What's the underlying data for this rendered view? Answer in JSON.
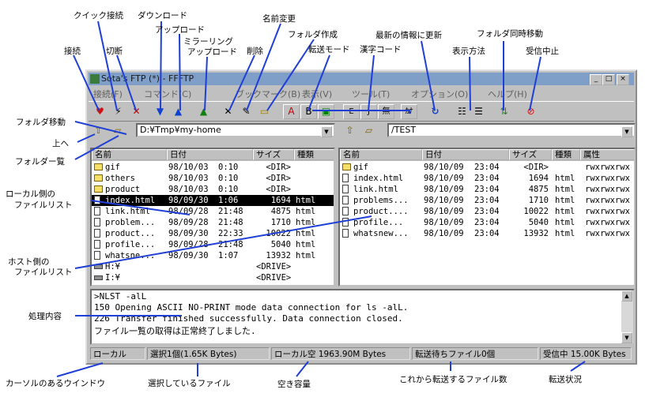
{
  "window": {
    "title": "Sota's FTP (*) - FFFTP",
    "buttons": [
      "_",
      "□",
      "×"
    ]
  },
  "menu": [
    "接続(F)",
    "コマンド(C)",
    "ブックマーク(B)",
    "表示(V)",
    "ツール(T)",
    "オプション(O)",
    "ヘルプ(H)"
  ],
  "local": {
    "path": "D:¥Tmp¥my-home",
    "headers": [
      "名前",
      "日付",
      "サイズ",
      "種類"
    ],
    "rows": [
      {
        "icon": "folder-icon",
        "name": "gif",
        "date": "98/10/03",
        "time": "0:10",
        "size": "<DIR>",
        "type": ""
      },
      {
        "icon": "folder-icon",
        "name": "others",
        "date": "98/10/03",
        "time": "0:10",
        "size": "<DIR>",
        "type": ""
      },
      {
        "icon": "folder-icon",
        "name": "product",
        "date": "98/10/03",
        "time": "0:10",
        "size": "<DIR>",
        "type": ""
      },
      {
        "icon": "file-icon",
        "name": "index.html",
        "date": "98/09/30",
        "time": "1:06",
        "size": "1694",
        "type": "html",
        "selected": true
      },
      {
        "icon": "file-icon",
        "name": "link.html",
        "date": "98/09/28",
        "time": "21:48",
        "size": "4875",
        "type": "html"
      },
      {
        "icon": "file-icon",
        "name": "problem...",
        "date": "98/09/28",
        "time": "21:48",
        "size": "1710",
        "type": "html"
      },
      {
        "icon": "file-icon",
        "name": "product...",
        "date": "98/09/30",
        "time": "22:33",
        "size": "10022",
        "type": "html"
      },
      {
        "icon": "file-icon",
        "name": "profile...",
        "date": "98/09/28",
        "time": "21:48",
        "size": "5040",
        "type": "html"
      },
      {
        "icon": "file-icon",
        "name": "whatsne...",
        "date": "98/09/30",
        "time": "1:07",
        "size": "13932",
        "type": "html"
      },
      {
        "icon": "drive-icon",
        "name": "H:¥",
        "date": "",
        "time": "",
        "size": "<DRIVE>",
        "type": ""
      },
      {
        "icon": "drive-icon",
        "name": "I:¥",
        "date": "",
        "time": "",
        "size": "<DRIVE>",
        "type": ""
      }
    ]
  },
  "host": {
    "path": "/TEST",
    "headers": [
      "名前",
      "日付",
      "サイズ",
      "種類",
      "属性"
    ],
    "rows": [
      {
        "icon": "folder-icon",
        "name": "gif",
        "date": "98/10/09",
        "time": "23:04",
        "size": "<DIR>",
        "type": "",
        "attr": "rwxrwxrwx"
      },
      {
        "icon": "file-icon",
        "name": "index.html",
        "date": "98/10/09",
        "time": "23:04",
        "size": "1694",
        "type": "html",
        "attr": "rwxrwxrwx"
      },
      {
        "icon": "file-icon",
        "name": "link.html",
        "date": "98/10/09",
        "time": "23:04",
        "size": "4875",
        "type": "html",
        "attr": "rwxrwxrwx"
      },
      {
        "icon": "file-icon",
        "name": "problems...",
        "date": "98/10/09",
        "time": "23:04",
        "size": "1710",
        "type": "html",
        "attr": "rwxrwxrwx"
      },
      {
        "icon": "file-icon",
        "name": "product....",
        "date": "98/10/09",
        "time": "23:04",
        "size": "10022",
        "type": "html",
        "attr": "rwxrwxrwx"
      },
      {
        "icon": "file-icon",
        "name": "profile...",
        "date": "98/10/09",
        "time": "23:04",
        "size": "5040",
        "type": "html",
        "attr": "rwxrwxrwx"
      },
      {
        "icon": "file-icon",
        "name": "whatsnew...",
        "date": "98/10/09",
        "time": "23:04",
        "size": "13932",
        "type": "html",
        "attr": "rwxrwxrwx"
      }
    ]
  },
  "log": [
    ">NLST -alL",
    "150 Opening ASCII NO-PRINT mode data connection for ls -alL.",
    "226 Transfer finished successfully. Data connection closed.",
    "ファイル一覧の取得は正常終了しました."
  ],
  "status": {
    "window": "ローカル",
    "selection": "選択1個(1.65K Bytes)",
    "free": "ローカル空 1963.90M Bytes",
    "queue": "転送待ちファイル0個",
    "recv": "受信中 15.00K Bytes"
  },
  "annotations": {
    "connect": "接続",
    "quick_connect": "クイック接続",
    "disconnect": "切断",
    "download": "ダウンロード",
    "upload": "アップロード",
    "mirror_upload_1": "ミラーリング",
    "mirror_upload_2": "アップロード",
    "delete": "削除",
    "rename": "名前変更",
    "mkdir": "フォルダ作成",
    "transfer_mode": "転送モード",
    "kanji_code": "漢字コード",
    "refresh": "最新の情報に更新",
    "view_mode": "表示方法",
    "sync_folder": "フォルダ同時移動",
    "abort": "受信中止",
    "folder_move": "フォルダ移動",
    "up": "上へ",
    "folder_list": "フォルダー覧",
    "local_list_1": "ローカル側の",
    "local_list_2": "ファイルリスト",
    "host_list_1": "ホスト側の",
    "host_list_2": "ファイルリスト",
    "process": "処理内容",
    "cursor_window": "カーソルのあるウインドウ",
    "selected_files": "選択しているファイル",
    "free_space": "空き容量",
    "pending": "これから転送するファイル数",
    "transfer_status": "転送状況"
  },
  "colors": {
    "annotation_line": "#1f3fd6",
    "titlebar": "#7f9fc8",
    "face": "#c0c0c0"
  }
}
